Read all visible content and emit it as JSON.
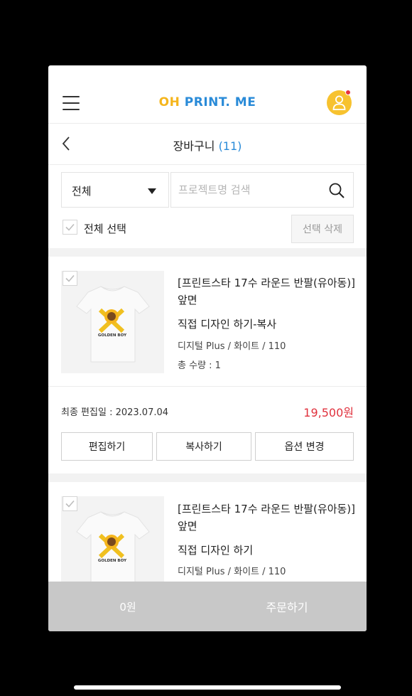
{
  "header": {
    "logo_oh": "OH",
    "logo_rest": "PRINT. ME",
    "menu_icon": "hamburger-icon",
    "profile_icon": "user-icon"
  },
  "subheader": {
    "title": "장바구니",
    "count": "(11)"
  },
  "filter": {
    "select_value": "전체",
    "search_placeholder": "프로젝트명 검색",
    "select_all_label": "전체 선택",
    "delete_selected_label": "선택 삭제"
  },
  "items": [
    {
      "product_name": "[프린트스타 17수 라운드 반팔(유아동)] 앞면",
      "design_name": "직접 디자인 하기-복사",
      "options": "디지털 Plus / 화이트 / 110",
      "quantity": "총 수량 : 1",
      "last_edit": "최종 편집일 : 2023.07.04",
      "price": "19,500원",
      "checked": true
    },
    {
      "product_name": "[프린트스타 17수 라운드 반팔(유아동)] 앞면",
      "design_name": "직접 디자인 하기",
      "options": "디지털 Plus / 화이트 / 110",
      "checked": true
    }
  ],
  "actions": {
    "edit": "편집하기",
    "copy": "복사하기",
    "change_option": "옵션 변경"
  },
  "thumb_text": "GOLDEN BOY",
  "bottom_bar": {
    "total": "0원",
    "order_label": "주문하기"
  },
  "colors": {
    "accent_blue": "#2a8bd8",
    "logo_yellow": "#f5b51c",
    "price_red": "#e0313d",
    "bottom_bar": "#c8c8c8"
  }
}
